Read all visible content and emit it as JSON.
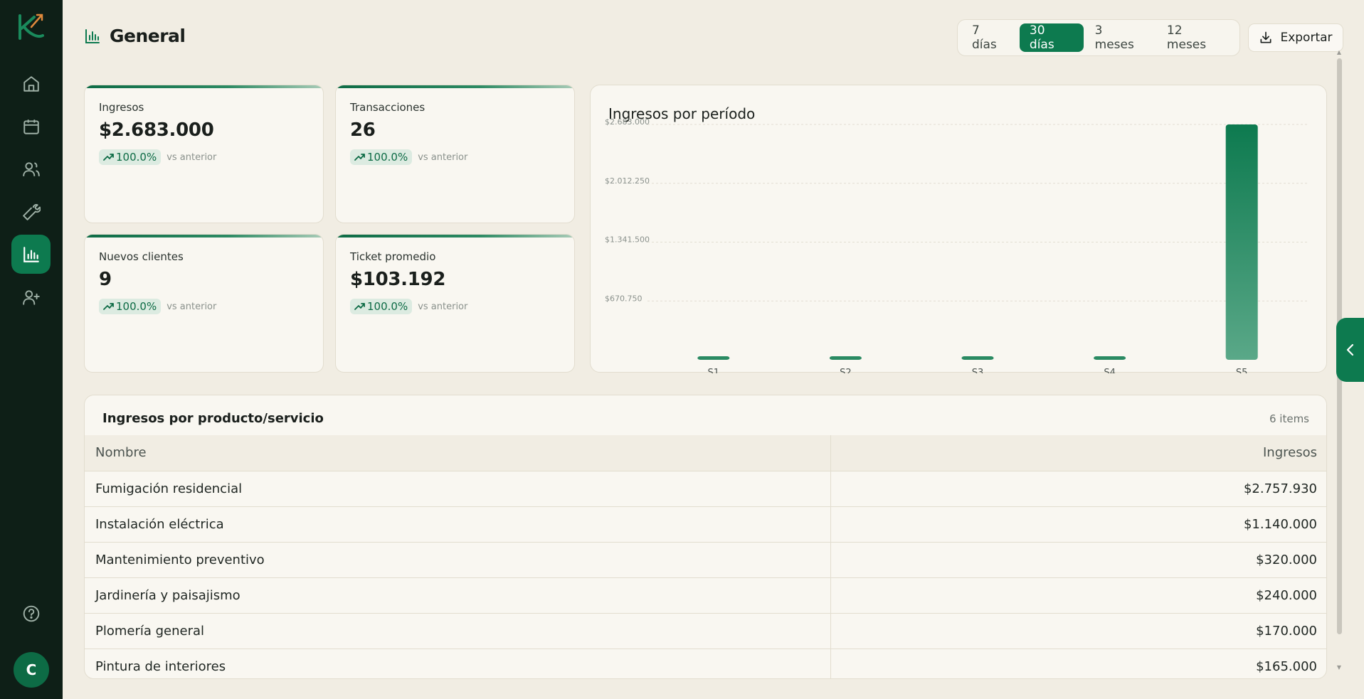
{
  "header": {
    "title": "General"
  },
  "ranges": [
    {
      "label": "7 días",
      "active": false
    },
    {
      "label": "30 días",
      "active": true
    },
    {
      "label": "3 meses",
      "active": false
    },
    {
      "label": "12 meses",
      "active": false
    }
  ],
  "export_label": "Exportar",
  "stats": [
    {
      "label": "Ingresos",
      "value": "$2.683.000",
      "delta": "100.0%",
      "note": "vs anterior"
    },
    {
      "label": "Transacciones",
      "value": "26",
      "delta": "100.0%",
      "note": "vs anterior"
    },
    {
      "label": "Nuevos clientes",
      "value": "9",
      "delta": "100.0%",
      "note": "vs anterior"
    },
    {
      "label": "Ticket promedio",
      "value": "$103.192",
      "delta": "100.0%",
      "note": "vs anterior"
    }
  ],
  "chart": {
    "title": "Ingresos por período"
  },
  "chart_data": {
    "type": "bar",
    "title": "Ingresos por período",
    "categories": [
      "S1",
      "S2",
      "S3",
      "S4",
      "S5"
    ],
    "values": [
      20000,
      20000,
      20000,
      20000,
      2683000
    ],
    "ylim": [
      0,
      2683000
    ],
    "ytick_values": [
      670750,
      1341500,
      2012250,
      2683000
    ],
    "ytick_labels": [
      "$670.750",
      "$1.341.500",
      "$2.012.250",
      "$2.683.000"
    ],
    "grid": true,
    "colors": {
      "bar_top": "#0d7a4f",
      "bar_bottom": "#5aa888"
    }
  },
  "table": {
    "title": "Ingresos por producto/servicio",
    "count": "6 items",
    "headers": [
      "Nombre",
      "Ingresos"
    ],
    "rows": [
      [
        "Fumigación residencial",
        "$2.757.930"
      ],
      [
        "Instalación eléctrica",
        "$1.140.000"
      ],
      [
        "Mantenimiento preventivo",
        "$320.000"
      ],
      [
        "Jardinería y paisajismo",
        "$240.000"
      ],
      [
        "Plomería general",
        "$170.000"
      ],
      [
        "Pintura de interiores",
        "$165.000"
      ]
    ]
  },
  "user": {
    "initial": "C"
  },
  "icons": {
    "nav": [
      "home-icon",
      "calendar-icon",
      "users-icon",
      "wrench-icon",
      "bar-chart-icon",
      "user-plus-icon"
    ],
    "help": "help-icon",
    "side_tab": "chevron-left-icon"
  },
  "colors": {
    "accent": "#0d7a4f",
    "sidebar": "#0e1f17",
    "background": "#f1ede3"
  }
}
